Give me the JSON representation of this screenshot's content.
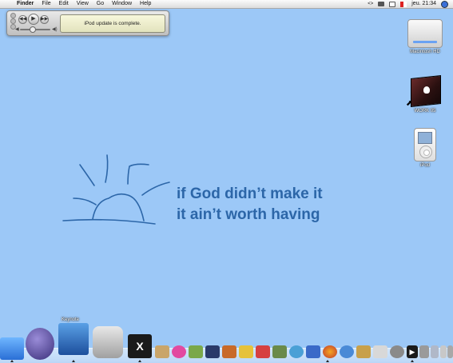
{
  "menubar": {
    "app_name": "Finder",
    "menus": [
      "File",
      "Edit",
      "View",
      "Go",
      "Window",
      "Help"
    ],
    "clock": "jeu. 21:34",
    "status_icons": [
      "script-menu-icon",
      "display-icon",
      "battery-icon",
      "flag-icon",
      "spotlight-icon"
    ]
  },
  "miniplayer": {
    "status_text": "iPod update is complete."
  },
  "desktop_icons": [
    {
      "label": "Macintosh HD",
      "icon": "hard-drive-icon"
    },
    {
      "label": "WORK 05",
      "icon": "work-folder-icon"
    },
    {
      "label": "iPod",
      "icon": "ipod-icon"
    }
  ],
  "wallpaper": {
    "line1": "if God didn’t make it",
    "line2": "it ain’t worth having",
    "text_color": "#2c66a8",
    "background_color": "#9cc8f7"
  },
  "dock": {
    "hover_label": "Keynote",
    "items": [
      "finder-icon",
      "ichat-icon",
      "keynote-icon",
      "preview-icon",
      "x11-icon",
      "iphoto-icon",
      "flower-icon",
      "pen-icon",
      "quicktime-icon",
      "gear-icon",
      "pencil-icon",
      "pdf-icon",
      "photo-icon",
      "itunes-icon",
      "mail-icon",
      "firefox-icon",
      "messenger-icon",
      "book-icon",
      "app-icon",
      "settings-icon",
      "terminal-icon",
      "calculator-icon",
      "network-icon",
      "printer-icon",
      "trash-icon"
    ]
  }
}
